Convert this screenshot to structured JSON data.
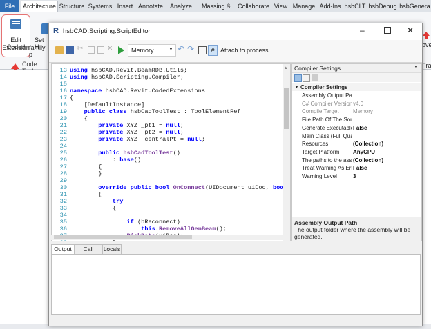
{
  "revit": {
    "tabs": [
      "File",
      "Architecture",
      "Structure",
      "Systems",
      "Insert",
      "Annotate",
      "Analyze",
      "Massing & Site",
      "Collaborate",
      "View",
      "Manage",
      "Add-Ins",
      "hsbCLT",
      "hsbDebug",
      "hsbGenera"
    ],
    "active_tab": "Architecture",
    "edit_button_label_1": "Edit Coded",
    "edit_button_label_2": "Extension",
    "seth_label_1": "Set H",
    "seth_label_2": "family p",
    "panel_label": "Code Tools",
    "right_label_1": "ove",
    "right_label_2": "Fra",
    "accent": "#e53935"
  },
  "editor": {
    "title": "hsbCAD.Scripting.ScriptEditor",
    "app_icon": "R",
    "window_controls": [
      "minimize-icon",
      "maximize-icon",
      "close-icon"
    ],
    "toolbar": {
      "mode_value": "Memory",
      "attach_label": "Attach to process"
    },
    "code_lines": [
      {
        "n": "13",
        "html": "<span class='kw'>using</span> hsbCAD.Revit.BeamRDB.Utils;"
      },
      {
        "n": "14",
        "html": "<span class='kw'>using</span> hsbCAD.Scripting.Compiler;"
      },
      {
        "n": "15",
        "html": ""
      },
      {
        "n": "16",
        "html": "<span class='kw'>namespace</span> hsbCAD.Revit.CodedExtensions"
      },
      {
        "n": "17",
        "html": "{"
      },
      {
        "n": "18",
        "html": "    [DefaultInstance]"
      },
      {
        "n": "19",
        "html": "    <span class='kw'>public class</span> hsbCadToolTest : ToolElementRef"
      },
      {
        "n": "20",
        "html": "    {"
      },
      {
        "n": "21",
        "html": "        <span class='kw'>private</span> XYZ _pt1 = <span class='kw'>null</span>;"
      },
      {
        "n": "22",
        "html": "        <span class='kw'>private</span> XYZ _pt2 = <span class='kw'>null</span>;"
      },
      {
        "n": "23",
        "html": "        <span class='kw'>private</span> XYZ _centralPt = <span class='kw'>null</span>;"
      },
      {
        "n": "24",
        "html": ""
      },
      {
        "n": "25",
        "html": "        <span class='kw'>public</span> <span class='fn'>hsbCadToolTest</span>()"
      },
      {
        "n": "26",
        "html": "            : <span class='kw'>base</span>()"
      },
      {
        "n": "27",
        "html": "        {"
      },
      {
        "n": "28",
        "html": "        }"
      },
      {
        "n": "29",
        "html": ""
      },
      {
        "n": "30",
        "html": "        <span class='kw'>override public bool</span> <span class='fn'>OnConnect</span>(UIDocument uiDoc, <span class='kw'>bool</span> bRecc"
      },
      {
        "n": "31",
        "html": "        {"
      },
      {
        "n": "32",
        "html": "            <span class='kw'>try</span>"
      },
      {
        "n": "33",
        "html": "            {"
      },
      {
        "n": "34",
        "html": ""
      },
      {
        "n": "35",
        "html": "                <span class='kw'>if</span> (bReconnect)"
      },
      {
        "n": "36",
        "html": "                    <span class='kw'>this</span>.<span class='fn'>RemoveAllGenBeam</span>();"
      },
      {
        "n": "37",
        "html": "                <span class='fn'>PickData</span>(uiDoc);"
      },
      {
        "n": "38",
        "html": "            }"
      }
    ],
    "properties": {
      "header": "Compiler Settings",
      "group": "Compiler Settings",
      "rows": [
        {
          "name": "Assembly Output Path",
          "value": "",
          "style": ""
        },
        {
          "name": "C# Compiler Version",
          "value": "v4.0",
          "style": "grey"
        },
        {
          "name": "Compile Target",
          "value": "Memory",
          "style": "grey"
        },
        {
          "name": "File Path Of The Source",
          "value": "",
          "style": ""
        },
        {
          "name": "Generate Executable",
          "value": "False",
          "style": "bold"
        },
        {
          "name": "Main Class (Full Qualified)",
          "value": "",
          "style": ""
        },
        {
          "name": "Resources",
          "value": "(Collection)",
          "style": "bold"
        },
        {
          "name": "Target Platform",
          "value": "AnyCPU",
          "style": "bold"
        },
        {
          "name": "The paths to the assemblies",
          "value": "(Collection)",
          "style": "bold"
        },
        {
          "name": "Treat Warning As Errors",
          "value": "False",
          "style": "bold"
        },
        {
          "name": "Warning Level",
          "value": "3",
          "style": "bold"
        }
      ],
      "desc_title": "Assembly Output Path",
      "desc_text_1": "The output folder where the assembly will be",
      "desc_text_2": "generated."
    },
    "bottom_tabs": [
      "Output",
      "Call Stack",
      "Locals"
    ]
  }
}
